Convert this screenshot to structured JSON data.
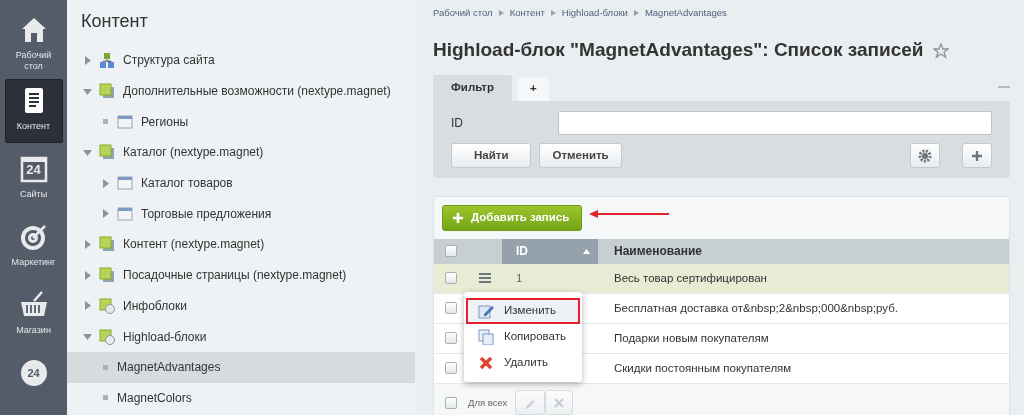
{
  "nav": [
    {
      "kind": "house",
      "label": "Рабочий стол",
      "selected": false
    },
    {
      "kind": "document",
      "label": "Контент",
      "selected": true
    },
    {
      "kind": "calendar",
      "icon_text": "24",
      "label": "Сайты",
      "selected": false
    },
    {
      "kind": "target",
      "label": "Маркетинг",
      "selected": false
    },
    {
      "kind": "basket",
      "label": "Магазин",
      "selected": false
    },
    {
      "kind": "cloud",
      "icon_text": "24",
      "selected": false
    }
  ],
  "sidebar": {
    "title": "Контент",
    "items": [
      {
        "label": "Структура сайта",
        "kind": "structure",
        "expanded": false,
        "selected": false
      },
      {
        "label": "Дополнительные возможности (nextype.magnet)",
        "kind": "module",
        "expanded": true,
        "selected": false,
        "children": [
          {
            "label": "Регионы",
            "kind": "table",
            "selected": false
          }
        ]
      },
      {
        "label": "Каталог (nextype.magnet)",
        "kind": "module",
        "expanded": true,
        "selected": false,
        "children": [
          {
            "label": "Каталог товаров",
            "kind": "table",
            "expanded": false,
            "selected": false
          },
          {
            "label": "Торговые предложения",
            "kind": "table",
            "expanded": false,
            "selected": false
          }
        ]
      },
      {
        "label": "Контент (nextype.magnet)",
        "kind": "module",
        "expanded": false,
        "selected": false
      },
      {
        "label": "Посадочные страницы (nextype.magnet)",
        "kind": "module",
        "expanded": false,
        "selected": false
      },
      {
        "label": "Инфоблоки",
        "kind": "blocks",
        "expanded": false,
        "selected": false
      },
      {
        "label": "Highload-блоки",
        "kind": "blocks",
        "expanded": true,
        "selected": false,
        "children": [
          {
            "label": "MagnetAdvantages",
            "selected": true
          },
          {
            "label": "MagnetColors",
            "selected": false
          }
        ]
      }
    ]
  },
  "breadcrumbs": [
    "Рабочий стол",
    "Контент",
    "Highload-блоки",
    "MagnetAdvantages"
  ],
  "title": "Highload-блок \"MagnetAdvantages\": Список записей",
  "filter": {
    "tabs": [
      {
        "label": "Фильтр",
        "selected": true
      },
      {
        "label": "+",
        "selected": false
      }
    ],
    "fields": [
      {
        "label": "ID"
      }
    ],
    "buttons": [
      "Найти",
      "Отменить"
    ]
  },
  "add_button": "Добавить запись",
  "table": {
    "all_checked": false,
    "columns": [
      {
        "label": "ID",
        "sorted": true
      },
      {
        "label": "Наименование",
        "sorted": false
      }
    ],
    "rows": [
      {
        "id": "1",
        "name": "Весь товар сертифицирован",
        "selected": true,
        "checked": false
      },
      {
        "name": "Бесплатная доставка от&nbsp;2&nbsp;000&nbsp;руб.",
        "selected": false,
        "checked": false
      },
      {
        "name": "Подарки новым покупателям",
        "selected": false,
        "checked": false
      },
      {
        "name": "Скидки постоянным покупателям",
        "selected": false,
        "checked": false
      }
    ],
    "footer": {
      "label": "Для всех",
      "checked": false
    }
  },
  "context_menu": {
    "items": [
      {
        "kind": "edit",
        "label": "Изменить",
        "highlighted": true
      },
      {
        "kind": "copy",
        "label": "Копировать",
        "highlighted": false
      },
      {
        "kind": "delete",
        "label": "Удалить",
        "highlighted": false
      }
    ]
  }
}
